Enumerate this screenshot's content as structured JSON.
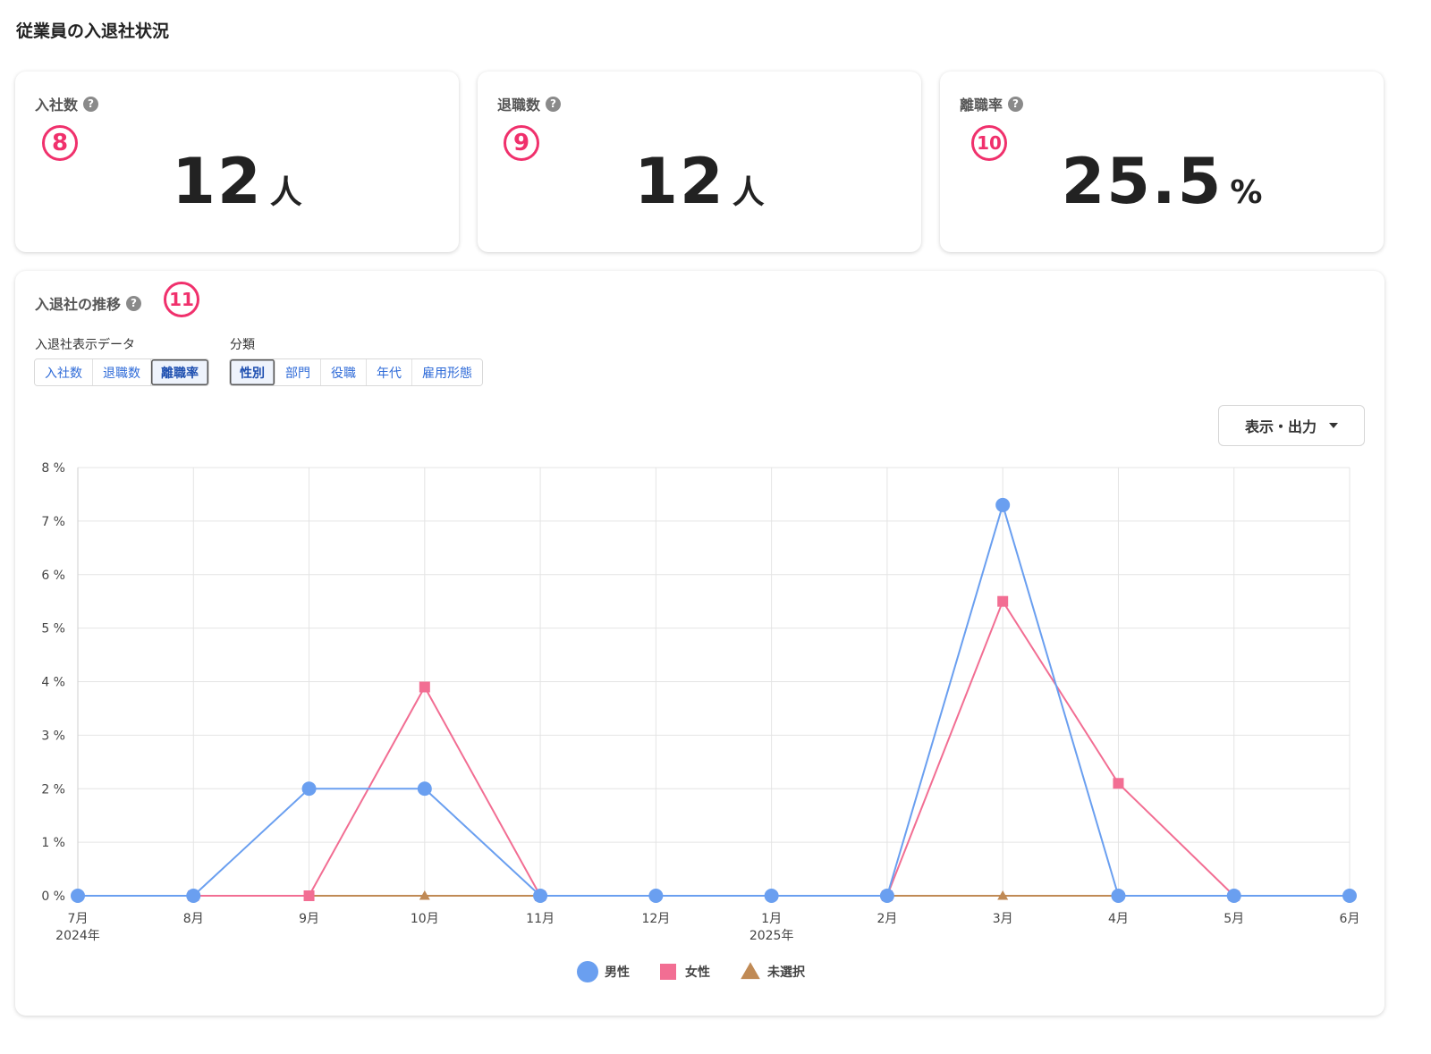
{
  "page": {
    "title": "従業員の入退社状況"
  },
  "kpis": [
    {
      "label": "入社数",
      "annotation": "8",
      "value": "12",
      "unit": "人"
    },
    {
      "label": "退職数",
      "annotation": "9",
      "value": "12",
      "unit": "人"
    },
    {
      "label": "離職率",
      "annotation": "10",
      "value": "25.5",
      "unit": "%"
    }
  ],
  "trend": {
    "title": "入退社の推移",
    "annotation": "11",
    "data_group_label": "入退社表示データ",
    "data_buttons": [
      "入社数",
      "退職数",
      "離職率"
    ],
    "data_active": 2,
    "category_group_label": "分類",
    "category_buttons": [
      "性別",
      "部門",
      "役職",
      "年代",
      "雇用形態"
    ],
    "category_active": 0,
    "export_label": "表示・出力"
  },
  "colors": {
    "male": "#6a9ff0",
    "female": "#f26e93",
    "unselected": "#c08a55",
    "annotation": "#f0306c"
  },
  "chart_data": {
    "type": "line",
    "categories": [
      "7月",
      "8月",
      "9月",
      "10月",
      "11月",
      "12月",
      "1月",
      "2月",
      "3月",
      "4月",
      "5月",
      "6月"
    ],
    "category_years": [
      "2024年",
      "",
      "",
      "",
      "",
      "",
      "2025年",
      "",
      "",
      "",
      "",
      ""
    ],
    "y_ticks": [
      "0 %",
      "1 %",
      "2 %",
      "3 %",
      "4 %",
      "5 %",
      "6 %",
      "7 %",
      "8 %"
    ],
    "ylim": [
      0,
      8
    ],
    "grid": true,
    "legend": "bottom",
    "series": [
      {
        "name": "男性",
        "marker": "circle",
        "values": [
          0,
          0,
          2,
          2,
          0,
          0,
          0,
          0,
          7.3,
          0,
          0,
          0
        ]
      },
      {
        "name": "女性",
        "marker": "square",
        "values": [
          null,
          0,
          0,
          3.9,
          0,
          null,
          null,
          0,
          5.5,
          2.1,
          0,
          null
        ]
      },
      {
        "name": "未選択",
        "marker": "triangle",
        "values": [
          null,
          null,
          0,
          0,
          0,
          null,
          null,
          0,
          0,
          0,
          null,
          null
        ]
      }
    ]
  }
}
